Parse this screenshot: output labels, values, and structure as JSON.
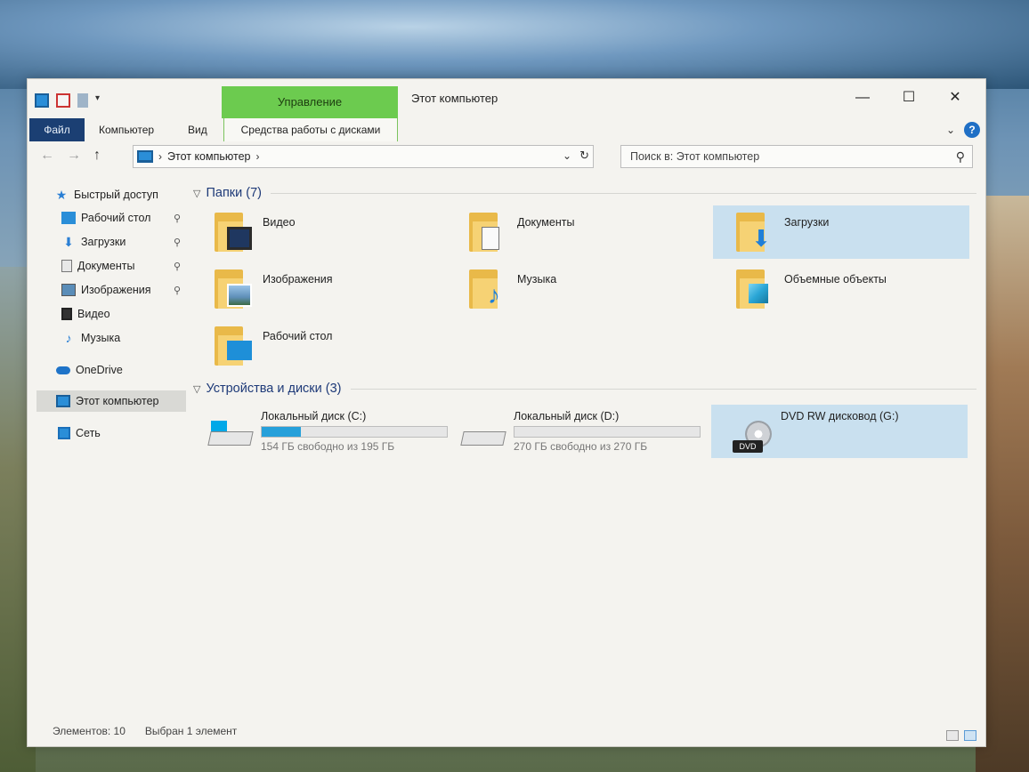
{
  "window": {
    "title": "Этот компьютер",
    "context_tab": "Управление",
    "controls": {
      "minimize": "—",
      "maximize": "☐",
      "close": "✕"
    }
  },
  "ribbon": {
    "tabs": [
      "Файл",
      "Компьютер",
      "Вид",
      "Средства работы с дисками"
    ],
    "expand": "⌄",
    "help": "?"
  },
  "address": {
    "path": "Этот компьютер",
    "separator": "›",
    "refresh": "↻",
    "dropdown": "⌄"
  },
  "nav_buttons": {
    "back": "←",
    "forward": "→",
    "up": "↑"
  },
  "search": {
    "placeholder": "Поиск в: Этот компьютер",
    "icon": "search-icon"
  },
  "sidebar": {
    "items": [
      {
        "label": "Быстрый доступ",
        "icon": "star-icon"
      },
      {
        "label": "Рабочий стол",
        "icon": "desktop-icon",
        "pinned": true
      },
      {
        "label": "Загрузки",
        "icon": "download-icon",
        "pinned": true
      },
      {
        "label": "Документы",
        "icon": "documents-icon",
        "pinned": true
      },
      {
        "label": "Изображения",
        "icon": "pictures-icon",
        "pinned": true
      },
      {
        "label": "Видео",
        "icon": "video-icon"
      },
      {
        "label": "Музыка",
        "icon": "music-icon"
      },
      {
        "label": "OneDrive",
        "icon": "cloud-icon"
      },
      {
        "label": "Этот компьютер",
        "icon": "computer-icon",
        "selected": true
      },
      {
        "label": "Сеть",
        "icon": "network-icon"
      }
    ],
    "pin_glyph": "📌"
  },
  "folders_group": {
    "title": "Папки (7)",
    "items": [
      {
        "name": "Видео",
        "icon": "video-folder-icon"
      },
      {
        "name": "Документы",
        "icon": "documents-folder-icon"
      },
      {
        "name": "Загрузки",
        "icon": "downloads-folder-icon",
        "selected": true
      },
      {
        "name": "Изображения",
        "icon": "pictures-folder-icon"
      },
      {
        "name": "Музыка",
        "icon": "music-folder-icon"
      },
      {
        "name": "Объемные объекты",
        "icon": "3d-objects-folder-icon"
      },
      {
        "name": "Рабочий стол",
        "icon": "desktop-folder-icon"
      }
    ]
  },
  "devices_group": {
    "title": "Устройства и диски (3)",
    "items": [
      {
        "name": "Локальный диск (C:)",
        "free": "154 ГБ свободно из 195 ГБ",
        "used_fraction": 0.21,
        "icon": "windows-drive-icon"
      },
      {
        "name": "Локальный диск (D:)",
        "free": "270 ГБ свободно из 270 ГБ",
        "used_fraction": 0.0,
        "icon": "hard-drive-icon"
      },
      {
        "name": "DVD RW дисковод (G:)",
        "icon": "dvd-drive-icon",
        "badge": "DVD",
        "selected": true
      }
    ]
  },
  "status": {
    "count": "Элементов: 10",
    "selection": "Выбран 1 элемент"
  },
  "colors": {
    "accent": "#26a0da",
    "file_tab": "#1b3f73",
    "context_tab": "#6ccb4f",
    "selection": "#c9e0ef",
    "group_header": "#1e3a78"
  }
}
